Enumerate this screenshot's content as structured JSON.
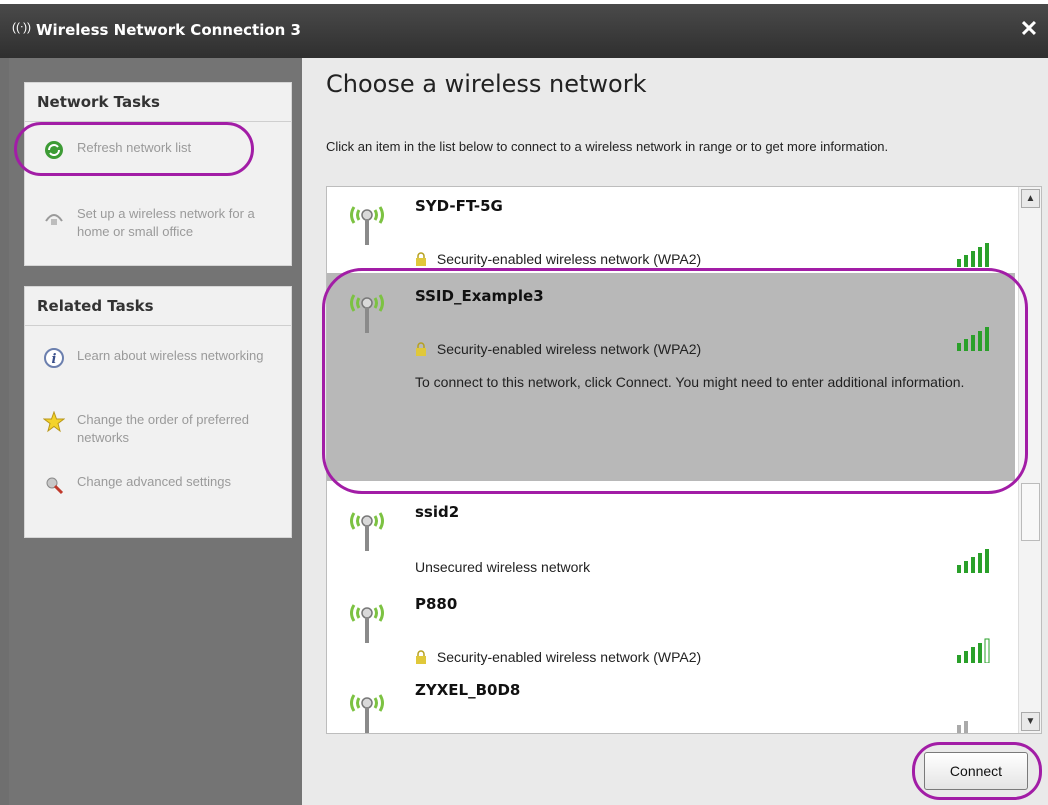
{
  "window": {
    "title": "Wireless Network Connection 3",
    "close_symbol": "✕"
  },
  "network_tasks": {
    "header": "Network Tasks",
    "items": [
      {
        "label": "Refresh network list",
        "icon": "refresh-icon"
      },
      {
        "label": "Set up a wireless network for a home or small office",
        "icon": "setup-wireless-icon"
      }
    ]
  },
  "related_tasks": {
    "header": "Related Tasks",
    "items": [
      {
        "label": "Learn about wireless networking",
        "icon": "info-icon"
      },
      {
        "label": "Change the order of preferred networks",
        "icon": "star-icon"
      },
      {
        "label": "Change advanced settings",
        "icon": "settings-icon"
      }
    ]
  },
  "main": {
    "heading": "Choose a wireless network",
    "instructions": "Click an item in the list below to connect to a wireless network in range or to get more information."
  },
  "networks": [
    {
      "ssid": "SYD-FT-5G",
      "security": "Security-enabled wireless network (WPA2)",
      "signal_bars": 5,
      "secured": true,
      "selected": false
    },
    {
      "ssid": "SSID_Example3",
      "security": "Security-enabled wireless network (WPA2)",
      "signal_bars": 5,
      "secured": true,
      "selected": true,
      "description": "To connect to this network, click Connect. You might need to enter additional information."
    },
    {
      "ssid": "ssid2",
      "security": "Unsecured wireless network",
      "signal_bars": 5,
      "secured": false,
      "selected": false
    },
    {
      "ssid": "P880",
      "security": "Security-enabled wireless network (WPA2)",
      "signal_bars": 4,
      "secured": true,
      "selected": false
    },
    {
      "ssid": "ZYXEL_B0D8",
      "security": "",
      "signal_bars": 2,
      "secured": false,
      "selected": false
    }
  ],
  "buttons": {
    "connect": "Connect"
  },
  "colors": {
    "highlight": "#a21da6",
    "signal_green": "#2aa02a",
    "selected_row": "#b8b8b8"
  }
}
